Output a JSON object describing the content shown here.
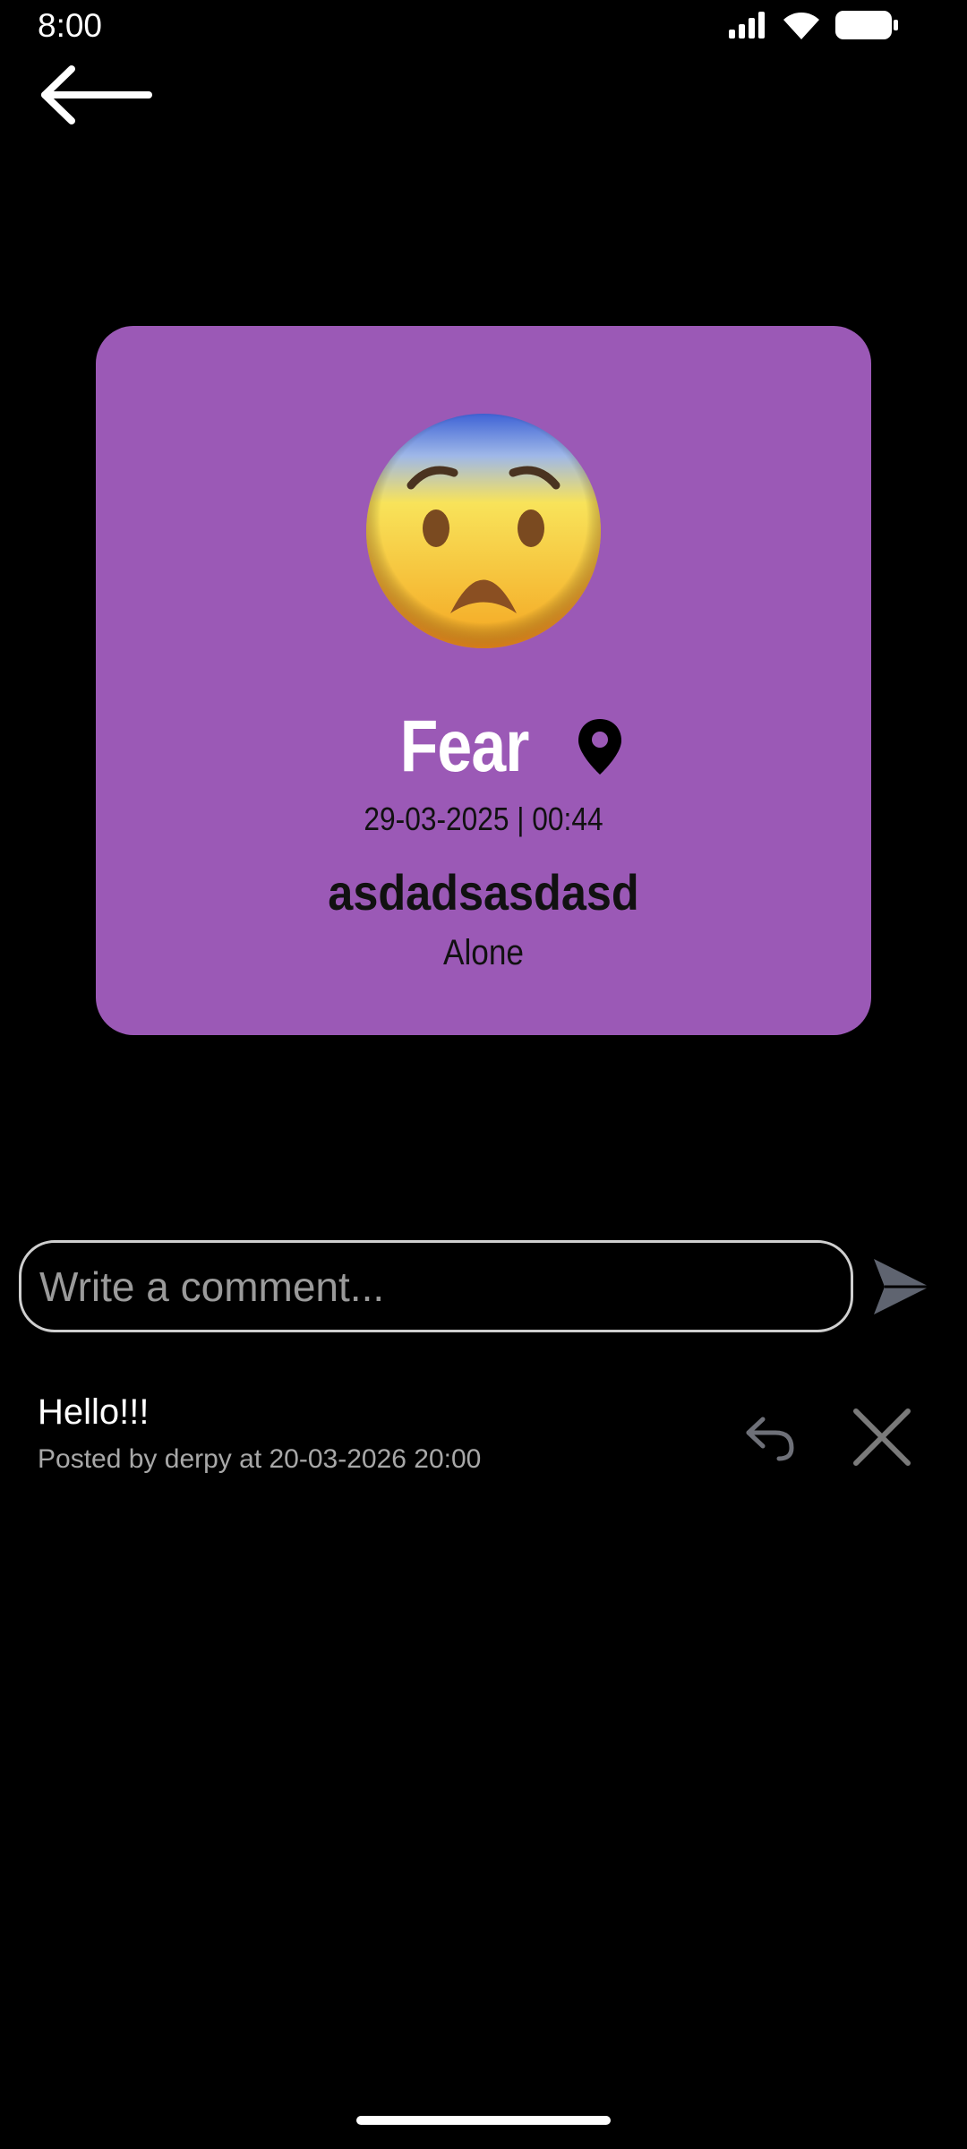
{
  "status_bar": {
    "time": "8:00",
    "icons": [
      "signal-icon",
      "wifi-icon",
      "battery-icon"
    ]
  },
  "header": {
    "back_icon": "arrow-left-icon"
  },
  "mood_card": {
    "background_color": "#9b59b6",
    "emoji": "fearful-face-emoji",
    "title": "Fear",
    "location_icon": "map-pin-icon",
    "date": "29-03-2025 | 00:44",
    "note": "asdadsasdasd",
    "company": "Alone"
  },
  "comment_box": {
    "placeholder": "Write a comment...",
    "value": "",
    "send_icon": "send-icon"
  },
  "comments": [
    {
      "text": "Hello!!!",
      "meta": "Posted by derpy at 20-03-2026 20:00",
      "reply_icon": "reply-icon",
      "delete_icon": "close-icon"
    }
  ]
}
